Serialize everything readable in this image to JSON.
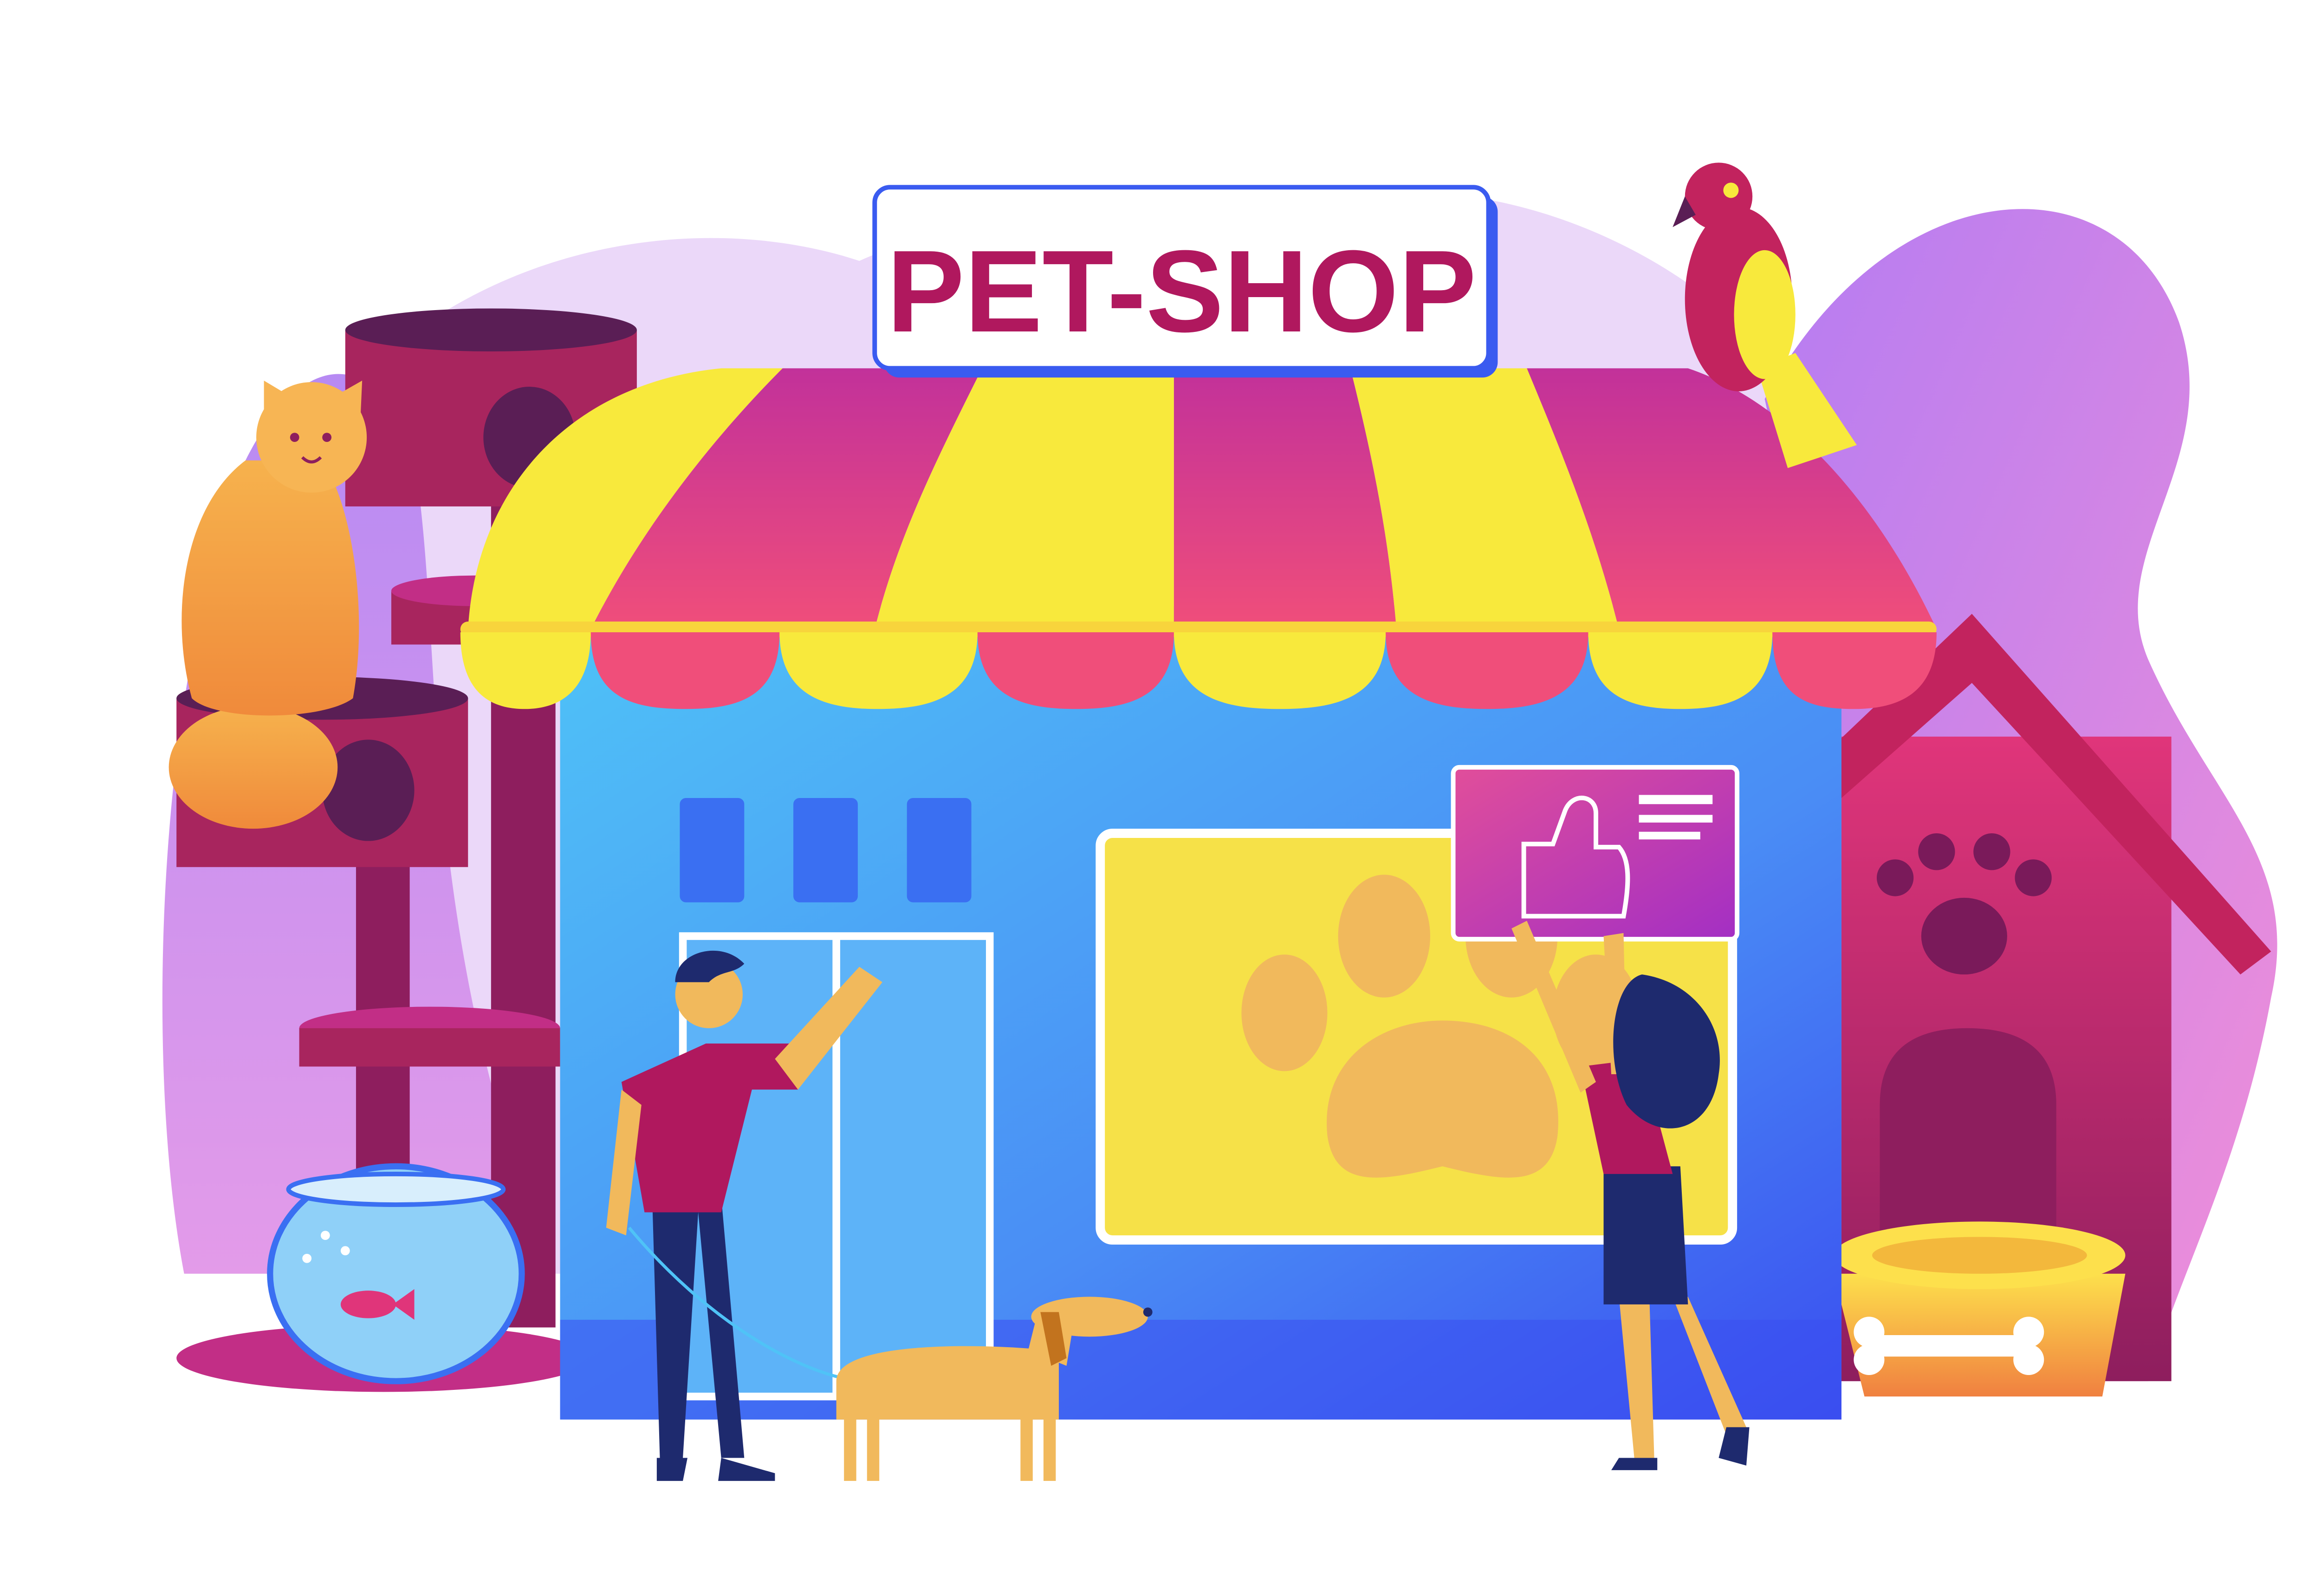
{
  "sign": {
    "label": "PET-SHOP"
  },
  "colors": {
    "background": "#ffffff",
    "blob_light": "#EAD6F8",
    "blob_violet": "#B07BF0",
    "blob_pink": "#E58BE8",
    "awning_yellow": "#F8E93C",
    "awning_pink": "#E8457C",
    "shop_blue": "#4FA8F5",
    "shop_blue_dark": "#3A6FF2",
    "window_yellow": "#F6E148",
    "paw_orange": "#F1B95C",
    "sign_text": "#B0185E",
    "sign_border": "#3A5BF0",
    "cat_orange": "#F7A84A",
    "magenta_dark": "#8E1E5E",
    "house_red": "#C2235E",
    "tablet_purple": "#B52FB0"
  },
  "icons": [
    "thumbs-up-icon",
    "paw-icon",
    "bone-icon",
    "fish-icon"
  ]
}
